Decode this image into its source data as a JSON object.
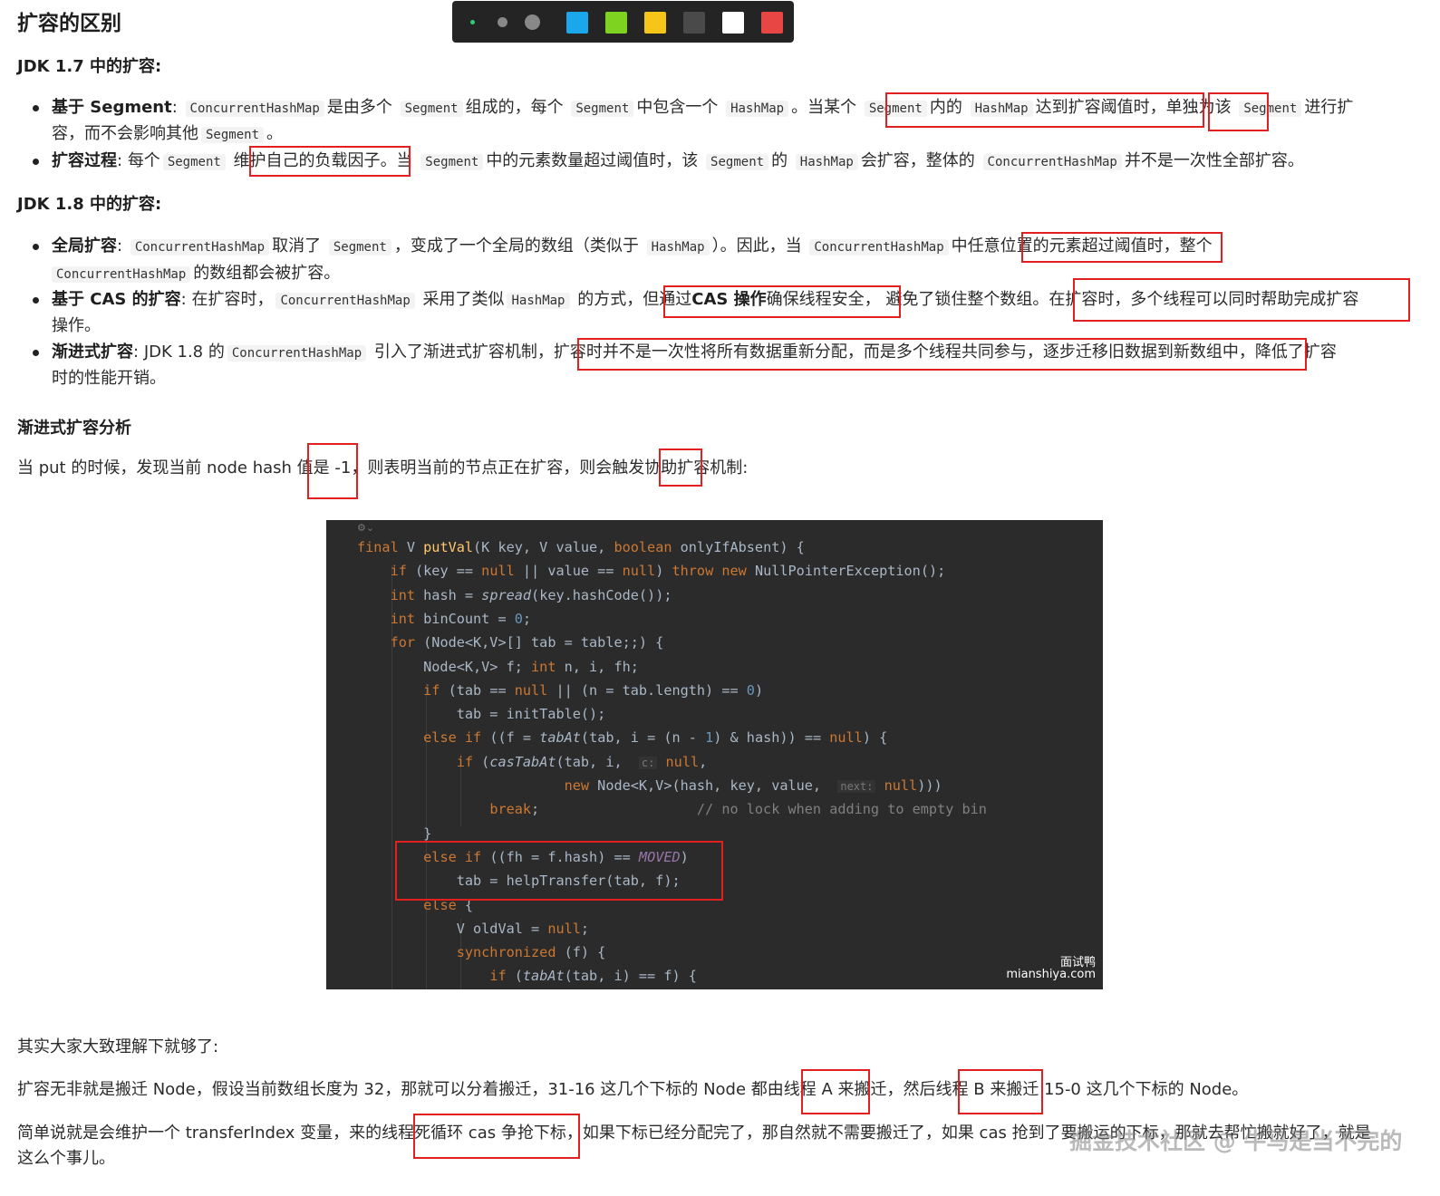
{
  "toolbar": {
    "colors": [
      "#1aa7ec",
      "#7ed321",
      "#f5c518",
      "#4a4a4a",
      "#ffffff",
      "#e84545"
    ]
  },
  "title": "扩容的区别",
  "jdk17": {
    "heading": "JDK 1.7 中的扩容:",
    "b1": {
      "label": "基于 Segment",
      "sep": ":",
      "t1": "ConcurrentHashMap",
      "t2": "是由多个",
      "t3": "Segment",
      "t4": "组成的，每个",
      "t5": "Segment",
      "t6": "中包含一个",
      "t7": "HashMap",
      "t8": "。当某个",
      "t9": "Segment",
      "t10": "内的",
      "t11": "HashMap",
      "t12": "达到扩容阈值时，",
      "t13": "单独为该",
      "t14": "Segment",
      "t15": "进行扩",
      "l2a": "容，而不会影响其他",
      "l2b": "Segment",
      "l2c": "。"
    },
    "b2": {
      "label": "扩容过程",
      "sep": ":",
      "t1": "每个",
      "t2": "Segment",
      "t3": "维护自己的负载因子",
      "t4": "。当",
      "t5": "Segment",
      "t6": "中的元素数量超过阈值时，该",
      "t7": "Segment",
      "t8": "的",
      "t9": "HashMap",
      "t10": "会扩容，整体的",
      "t11": "ConcurrentHashMap",
      "t12": "并不是一次性全部扩容。"
    }
  },
  "jdk18": {
    "heading": "JDK 1.8 中的扩容:",
    "b1": {
      "label": "全局扩容",
      "sep": ":",
      "t1": "ConcurrentHashMap",
      "t2": "取消了",
      "t3": "Segment",
      "t4": "，变成了一个全局的数组（类似于",
      "t5": "HashMap",
      "t6": "）。因此，当",
      "t7": "ConcurrentHashMap",
      "t8": "中任意位置的元素超过阈值时，整个",
      "l2a": "ConcurrentHashMap",
      "l2b": "的数组都会被扩容。"
    },
    "b2": {
      "label": "基于 CAS 的扩容",
      "sep": ":",
      "t1": "在扩容时，",
      "t2": "ConcurrentHashMap",
      "t3": "采用了类似",
      "t4": "HashMap",
      "t5": "的方式，",
      "t6": "但通过",
      "t7": "CAS 操作",
      "t8": "确保线程安全，",
      "t9": "避免了锁住整个数组。",
      "t10": "在扩容时，多个线程可以同时帮助完成扩容",
      "l2": "操作。"
    },
    "b3": {
      "label": "渐进式扩容",
      "sep": ":",
      "t1": "JDK 1.8 的",
      "t2": "ConcurrentHashMap",
      "t3": "引入了渐进式扩容机制，",
      "t4": "扩容时并不是一次性将所有数据重新分配，而是多个线程共同参与，逐步迁移旧数据到新数组中，",
      "t5": "降低了扩容",
      "l2": "时的性能开销。"
    }
  },
  "analysis": {
    "heading": "渐进式扩容分析",
    "intro": "当 put 的时候，发现当前 node hash 值是 -1，则表明当前的节点正在扩容，则会触发协助扩容机制:"
  },
  "code": {
    "watermark_cn": "面试鸭",
    "watermark_url": "mianshiya.com",
    "lines": [
      "final V putVal(K key, V value, boolean onlyIfAbsent) {",
      "    if (key == null || value == null) throw new NullPointerException();",
      "    int hash = spread(key.hashCode());",
      "    int binCount = 0;",
      "    for (Node<K,V>[] tab = table;;) {",
      "        Node<K,V> f; int n, i, fh;",
      "        if (tab == null || (n = tab.length) == 0)",
      "            tab = initTable();",
      "        else if ((f = tabAt(tab, i = (n - 1) & hash)) == null) {",
      "            if (casTabAt(tab, i,  c: null,",
      "                         new Node<K,V>(hash, key, value,  next: null)))",
      "                break;                   // no lock when adding to empty bin",
      "        }",
      "        else if ((fh = f.hash) == MOVED)",
      "            tab = helpTransfer(tab, f);",
      "        else {",
      "            V oldVal = null;",
      "            synchronized (f) {",
      "                if (tabAt(tab, i) == f) {"
    ]
  },
  "summary": {
    "p1": "其实大家大致理解下就够了:",
    "p2": "扩容无非就是搬迁 Node，假设当前数组长度为 32，那就可以分着搬迁，31-16 这几个下标的 Node 都由线程 A 来搬迁，然后线程 B 来搬迁 15-0 这几个下标的 Node。",
    "p3": "简单说就是会维护一个 transferIndex 变量，来的线程死循环 cas 争抢下标，如果下标已经分配完了，那自然就不需要搬迁了，如果 cas 抢到了要搬运的下标，那就去帮忙搬就好了，就是",
    "p4": "这么个事儿。",
    "watermark": "掘金技术社区 @ 牛马是当不完的"
  }
}
